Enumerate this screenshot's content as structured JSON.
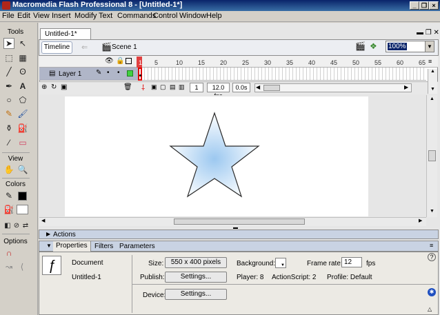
{
  "window": {
    "title": "Macromedia Flash Professional 8 - [Untitled-1*]"
  },
  "menu": [
    "File",
    "Edit",
    "View",
    "Insert",
    "Modify",
    "Text",
    "Commands",
    "Control",
    "Window",
    "Help"
  ],
  "tools": {
    "tools_label": "Tools",
    "view_label": "View",
    "colors_label": "Colors",
    "options_label": "Options"
  },
  "document": {
    "tab_label": "Untitled-1*",
    "timeline_label": "Timeline",
    "scene_label": "Scene 1",
    "zoom_value": "100%"
  },
  "timeline": {
    "frame_numbers": [
      "1",
      "5",
      "10",
      "15",
      "20",
      "25",
      "30",
      "35",
      "40",
      "45",
      "50",
      "55",
      "60",
      "65"
    ],
    "layer_name": "Layer 1",
    "current_frame": "1",
    "fps": "12.0 fps",
    "elapsed": "0.0s"
  },
  "panels": {
    "actions_label": "Actions",
    "tabs": [
      "Properties",
      "Filters",
      "Parameters"
    ]
  },
  "properties": {
    "doc_type": "Document",
    "doc_name": "Untitled-1",
    "size_label": "Size:",
    "size_value": "550 x 400 pixels",
    "publish_label": "Publish:",
    "settings_label": "Settings...",
    "device_label": "Device:",
    "device_settings_label": "Settings...",
    "background_label": "Background:",
    "frame_rate_label": "Frame rate:",
    "frame_rate_value": "12",
    "fps_unit": "fps",
    "player_text": "Player: 8",
    "actionscript_text": "ActionScript: 2",
    "profile_text": "Profile: Default"
  },
  "colors": {
    "title_start": "#0a246a",
    "title_end": "#3a6ea5",
    "panel_header": "#c9d3e3",
    "star_stroke": "#2a2a2a",
    "star_fill_center": "#9cc8f0"
  }
}
